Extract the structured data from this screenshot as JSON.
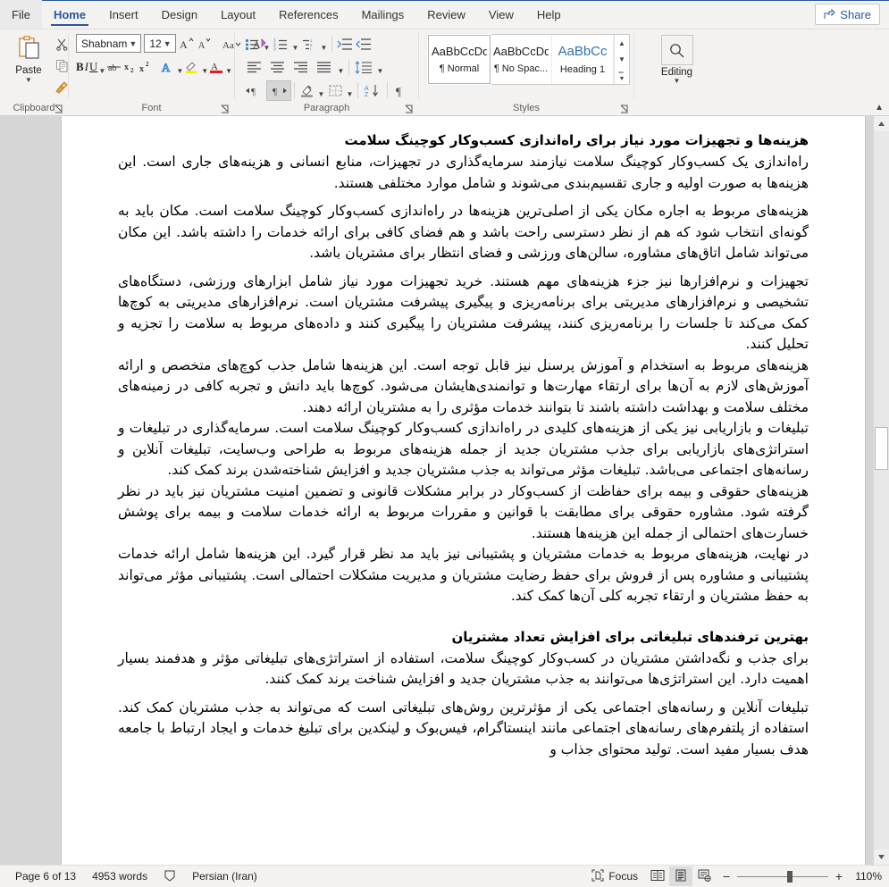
{
  "tabs": [
    {
      "label": "File",
      "active": false
    },
    {
      "label": "Home",
      "active": true
    },
    {
      "label": "Insert",
      "active": false
    },
    {
      "label": "Design",
      "active": false
    },
    {
      "label": "Layout",
      "active": false
    },
    {
      "label": "References",
      "active": false
    },
    {
      "label": "Mailings",
      "active": false
    },
    {
      "label": "Review",
      "active": false
    },
    {
      "label": "View",
      "active": false
    },
    {
      "label": "Help",
      "active": false
    }
  ],
  "share": {
    "label": "Share",
    "icon": "share-icon"
  },
  "ribbon": {
    "clipboard": {
      "group_label": "Clipboard",
      "paste_label": "Paste",
      "paste_icon": "paste-icon",
      "cut_icon": "scissors-icon",
      "copy_icon": "copy-icon",
      "format_painter_icon": "format-painter-icon",
      "dialog_launcher_icon": "dialog-launcher-icon"
    },
    "font": {
      "group_label": "Font",
      "font_name": "Shabnam",
      "font_size": "12",
      "grow_font_icon": "grow-font-icon",
      "shrink_font_icon": "shrink-font-icon",
      "change_case_icon": "change-case-icon",
      "clear_formatting_icon": "clear-formatting-icon",
      "bold_label": "B",
      "italic_label": "I",
      "underline_label": "U",
      "strikethrough_icon": "strikethrough-icon",
      "subscript_label": "x",
      "superscript_label": "x",
      "text_effects_icon": "text-effects-icon",
      "highlight_icon": "text-highlight-icon",
      "font_color_icon": "font-color-icon",
      "dialog_launcher_icon": "dialog-launcher-icon"
    },
    "paragraph": {
      "group_label": "Paragraph",
      "bullets_icon": "bullets-icon",
      "numbering_icon": "numbering-icon",
      "multilevel_icon": "multilevel-list-icon",
      "decrease_indent_icon": "decrease-indent-icon",
      "increase_indent_icon": "increase-indent-icon",
      "align_left_icon": "align-left-icon",
      "align_center_icon": "align-center-icon",
      "align_right_icon": "align-right-icon",
      "justify_icon": "justify-icon",
      "line_spacing_icon": "line-spacing-icon",
      "ltr_icon": "left-to-right-text-icon",
      "rtl_icon": "right-to-left-text-icon",
      "shading_icon": "shading-icon",
      "borders_icon": "borders-icon",
      "sort_icon": "sort-icon",
      "show_marks_icon": "show-formatting-marks-icon",
      "dialog_launcher_icon": "dialog-launcher-icon"
    },
    "styles": {
      "group_label": "Styles",
      "items": [
        {
          "preview": "AaBbCcDd",
          "name": "¶ Normal",
          "selected": true
        },
        {
          "preview": "AaBbCcDd",
          "name": "¶ No Spac...",
          "selected": false
        },
        {
          "preview": "AaBbCc",
          "name": "Heading 1",
          "selected": false
        }
      ],
      "scroll_up_icon": "scroll-up-icon",
      "scroll_down_icon": "scroll-down-icon",
      "more_icon": "more-styles-icon",
      "dialog_launcher_icon": "dialog-launcher-icon"
    },
    "editing": {
      "group_label": "",
      "label": "Editing",
      "icon": "search-icon",
      "dropdown_icon": "chevron-down-icon"
    },
    "collapse_icon": "collapse-ribbon-icon"
  },
  "document": {
    "blocks": [
      {
        "type": "heading",
        "text": "هزینه‌ها و تجهیزات مورد نیاز برای راه‌اندازی کسب‌وکار کوچینگ سلامت"
      },
      {
        "type": "para",
        "text": "راه‌اندازی یک کسب‌وکار کوچینگ سلامت نیازمند سرمایه‌گذاری در تجهیزات، منابع انسانی و هزینه‌های جاری است. این هزینه‌ها به صورت اولیه و جاری تقسیم‌بندی می‌شوند و شامل موارد مختلفی هستند."
      },
      {
        "type": "para",
        "text": "هزینه‌های مربوط به اجاره مکان یکی از اصلی‌ترین هزینه‌ها در راه‌اندازی کسب‌وکار کوچینگ سلامت است. مکان باید به گونه‌ای انتخاب شود که هم از نظر دسترسی راحت باشد و هم فضای کافی برای ارائه خدمات را داشته باشد. این مکان می‌تواند شامل اتاق‌های مشاوره، سالن‌های ورزشی و فضای انتظار برای مشتریان باشد."
      },
      {
        "type": "para",
        "text": "تجهیزات و نرم‌افزارها نیز جزء هزینه‌های مهم هستند. خرید تجهیزات مورد نیاز شامل ابزارهای ورزشی، دستگاه‌های تشخیصی و نرم‌افزارهای مدیریتی برای برنامه‌ریزی و پیگیری پیشرفت مشتریان است. نرم‌افزارهای مدیریتی به کوچ‌ها کمک می‌کند تا جلسات را برنامه‌ریزی کنند، پیشرفت مشتریان را پیگیری کنند و داده‌های مربوط به سلامت را تجزیه و تحلیل کنند."
      },
      {
        "type": "para",
        "text": "هزینه‌های مربوط به استخدام و آموزش پرسنل نیز قابل توجه است. این هزینه‌ها شامل جذب کوچ‌های متخصص و ارائه آموزش‌های لازم به آن‌ها برای ارتقاء مهارت‌ها و توانمندی‌هایشان می‌شود. کوچ‌ها باید دانش و تجربه کافی در زمینه‌های مختلف سلامت و بهداشت داشته باشند تا بتوانند خدمات مؤثری را به مشتریان ارائه دهند."
      },
      {
        "type": "para",
        "text": "تبلیغات و بازاریابی نیز یکی از هزینه‌های کلیدی در راه‌اندازی کسب‌وکار کوچینگ سلامت است. سرمایه‌گذاری در تبلیغات و استراتژی‌های بازاریابی برای جذب مشتریان جدید از جمله هزینه‌های مربوط به طراحی وب‌سایت، تبلیغات آنلاین و رسانه‌های اجتماعی می‌باشد. تبلیغات مؤثر می‌تواند به جذب مشتریان جدید و افزایش شناخته‌شدن برند کمک کند."
      },
      {
        "type": "para",
        "text": "هزینه‌های حقوقی و بیمه برای حفاظت از کسب‌وکار در برابر مشکلات قانونی و تضمین امنیت مشتریان نیز باید در نظر گرفته شود. مشاوره حقوقی برای مطابقت با قوانین و مقررات مربوط به ارائه خدمات سلامت و بیمه برای پوشش خسارت‌های احتمالی از جمله این هزینه‌ها هستند."
      },
      {
        "type": "para",
        "text": "در نهایت، هزینه‌های مربوط به خدمات مشتریان و پشتیبانی نیز باید مد نظر قرار گیرد. این هزینه‌ها شامل ارائه خدمات پشتیبانی و مشاوره پس از فروش برای حفظ رضایت مشتریان و مدیریت مشکلات احتمالی است. پشتیبانی مؤثر می‌تواند به حفظ مشتریان و ارتقاء تجربه کلی آن‌ها کمک کند."
      },
      {
        "type": "heading_spaced",
        "text": "بهترین ترفندهای تبلیغاتی برای افزایش تعداد مشتریان"
      },
      {
        "type": "para",
        "text": "برای جذب و نگه‌داشتن مشتریان در کسب‌وکار کوچینگ سلامت، استفاده از استراتژی‌های تبلیغاتی مؤثر و هدفمند بسیار اهمیت دارد. این استراتژی‌ها می‌توانند به جذب مشتریان جدید و افزایش شناخت برند کمک کنند."
      },
      {
        "type": "para",
        "text": "تبلیغات آنلاین و رسانه‌های اجتماعی یکی از مؤثرترین روش‌های تبلیغاتی است که می‌تواند به جذب مشتریان کمک کند. استفاده از پلتفرم‌های رسانه‌های اجتماعی مانند اینستاگرام، فیس‌بوک و لینکدین برای تبلیغ خدمات و ایجاد ارتباط با جامعه هدف بسیار مفید است. تولید محتوای جذاب و"
      }
    ]
  },
  "scrollbar": {
    "up_icon": "scroll-up-arrow-icon",
    "down_icon": "scroll-down-arrow-icon",
    "thumb_top_pct": 40,
    "thumb_height_pct": 5.5
  },
  "status": {
    "page_text": "Page 6 of 13",
    "word_count": "4953 words",
    "proofing_icon": "proofing-errors-icon",
    "language": "Persian (Iran)",
    "focus_label": "Focus",
    "focus_icon": "focus-mode-icon",
    "read_mode_icon": "read-mode-icon",
    "print_layout_icon": "print-layout-icon",
    "web_layout_icon": "web-layout-icon",
    "zoom_out_label": "−",
    "zoom_in_label": "+",
    "zoom_value": "110%"
  }
}
